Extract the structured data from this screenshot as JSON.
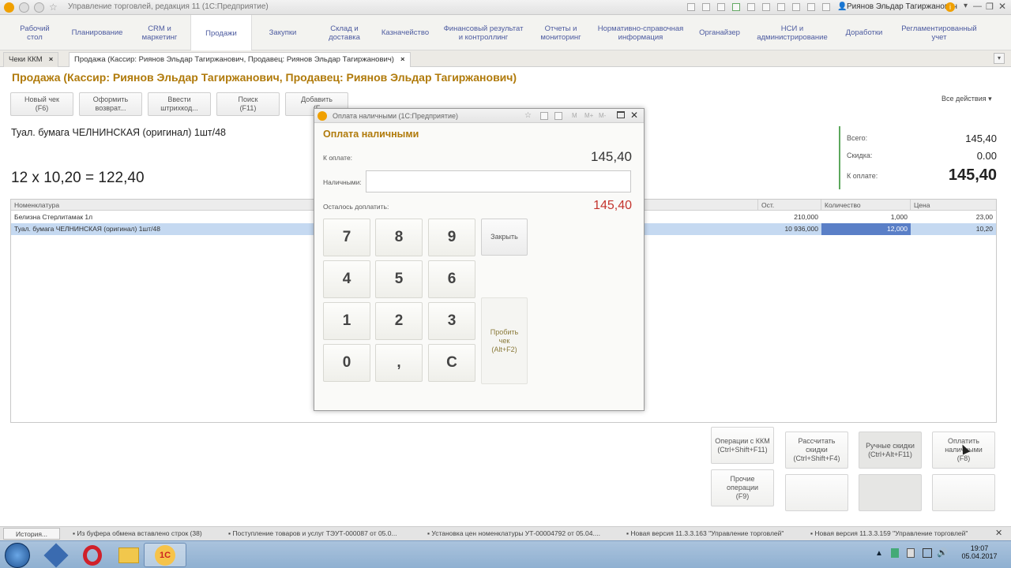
{
  "window": {
    "title": "Управление торговлей, редакция 11 (1С:Предприятие)",
    "user": "Риянов Эльдар Тагиржанович"
  },
  "menu": [
    {
      "label": "Рабочий\nстол"
    },
    {
      "label": "Планирование"
    },
    {
      "label": "CRM и\nмаркетинг"
    },
    {
      "label": "Продажи"
    },
    {
      "label": "Закупки"
    },
    {
      "label": "Склад и\nдоставка"
    },
    {
      "label": "Казначейство"
    },
    {
      "label": "Финансовый результат\nи контроллинг"
    },
    {
      "label": "Отчеты и\nмониторинг"
    },
    {
      "label": "Нормативно-справочная\nинформация"
    },
    {
      "label": "Органайзер"
    },
    {
      "label": "НСИ и\nадминистрирование"
    },
    {
      "label": "Доработки"
    },
    {
      "label": "Регламентированный\nучет"
    }
  ],
  "tabs": [
    {
      "label": "Чеки ККМ",
      "close": "×"
    },
    {
      "label": "Продажа (Кассир: Риянов Эльдар Тагиржанович, Продавец: Риянов Эльдар Тагиржанович)",
      "close": "×"
    }
  ],
  "page": {
    "title": "Продажа (Кассир: Риянов Эльдар Тагиржанович, Продавец: Риянов Эльдар Тагиржанович)",
    "all_actions": "Все действия ▾",
    "product_name": "Туал. бумага ЧЕЛНИНСКАЯ (оригинал) 1шт/48",
    "calc": "12 x 10,20 = 122,40"
  },
  "toolbar": [
    {
      "label": "Новый чек\n(F6)"
    },
    {
      "label": "Оформить\nвозврат..."
    },
    {
      "label": "Ввести\nштрихкод..."
    },
    {
      "label": "Поиск\n(F11)"
    },
    {
      "label": "Добавить\n(F"
    }
  ],
  "totals": {
    "total_label": "Всего:",
    "total_value": "145,40",
    "discount_label": "Скидка:",
    "discount_value": "0.00",
    "topay_label": "К оплате:",
    "topay_value": "145,40"
  },
  "table": {
    "headers": {
      "name": "Номенклатура",
      "rest": "Ост.",
      "qty": "Количество",
      "price": "Цена"
    },
    "rows": [
      {
        "name": "Белизна Стерлитамак 1л",
        "rest": "210,000",
        "qty": "1,000",
        "price": "23,00"
      },
      {
        "name": "Туал. бумага ЧЕЛНИНСКАЯ (оригинал) 1шт/48",
        "rest": "10 936,000",
        "qty": "12,000",
        "price": "10,20"
      }
    ]
  },
  "bottom_buttons": [
    {
      "label": "Операции с ККМ\n(Ctrl+Shift+F11)"
    },
    {
      "label": "Рассчитать\nскидки\n(Ctrl+Shift+F4)"
    },
    {
      "label": "Ручные скидки\n(Ctrl+Alt+F11)"
    },
    {
      "label": "Оплатить\nналичными\n(F8)"
    },
    {
      "label": "Прочие\nоперации\n(F9)"
    }
  ],
  "dialog": {
    "window_title": "Оплата наличными  (1С:Предприятие)",
    "title": "Оплата наличными",
    "topay_label": "К оплате:",
    "topay_value": "145,40",
    "cash_label": "Наличными:",
    "cash_value": "",
    "remain_label": "Осталось доплатить:",
    "remain_value": "145,40",
    "keys": [
      "7",
      "8",
      "9",
      "4",
      "5",
      "6",
      "1",
      "2",
      "3",
      "0",
      ",",
      "C"
    ],
    "close_label": "Закрыть",
    "print_label": "Пробить\nчек\n(Alt+F2)"
  },
  "status": [
    {
      "label": "История..."
    },
    {
      "label": "Из буфера обмена вставлено строк (38)"
    },
    {
      "label": "Поступление товаров и услуг ТЭУТ-000087 от 05.0..."
    },
    {
      "label": "Установка цен номенклатуры УТ-00004792 от 05.04...."
    },
    {
      "label": "Новая версия 11.3.3.163 \"Управление торговлей\""
    },
    {
      "label": "Новая версия 11.3.3.159 \"Управление торговлей\""
    }
  ],
  "taskbar": {
    "time": "19:07",
    "date": "05.04.2017"
  },
  "colors": {
    "accent": "#b07a0a",
    "menu_text": "#4d5ba0",
    "selected_row": "#c5d9f1",
    "remain": "#c4342d"
  }
}
